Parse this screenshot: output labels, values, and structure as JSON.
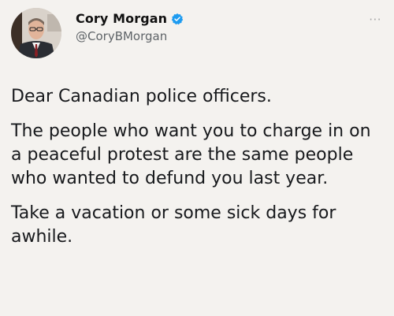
{
  "tweet": {
    "author": {
      "display_name": "Cory Morgan",
      "handle": "@CoryBMorgan",
      "verified_icon": "verified-badge-icon",
      "avatar_icon": "profile-photo"
    },
    "more_label": "···",
    "paragraphs": [
      "Dear Canadian police officers.",
      "The people who want you to charge in on a peaceful protest are the same people who wanted to defund you last year.",
      "Take a vacation or some sick days for awhile."
    ]
  },
  "colors": {
    "verified_blue": "#1d9bf0",
    "text": "#17191c",
    "handle": "#5f6468",
    "background": "#f4f2ef"
  }
}
